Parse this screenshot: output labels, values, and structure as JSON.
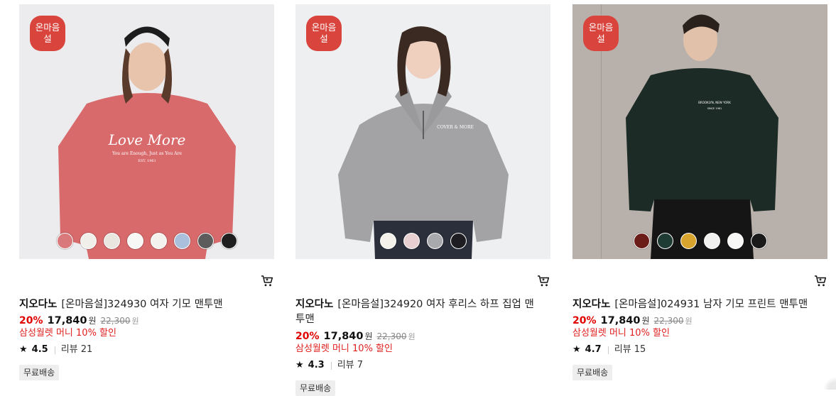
{
  "products": [
    {
      "badge": [
        "온마음",
        "설"
      ],
      "brand": "지오다노",
      "name": "[온마음설]324930 여자 기모 맨투맨",
      "discount": "20%",
      "price": "17,840",
      "currency": "원",
      "original_price": "22,300",
      "promo": "삼성월렛 머니 10% 할인",
      "rating": "4.5",
      "review_label": "리뷰 21",
      "shipping": "무료배송",
      "photo_bg": "#ececee",
      "garment_color": "#d86a6c",
      "swatch_colors": [
        "#d9797b",
        "#f0efe9",
        "#e8e6df",
        "#f7f7f5",
        "#f3f2ee",
        "#a9bfdc",
        "#5c5c5c",
        "#1f1f1f"
      ]
    },
    {
      "badge": [
        "온마음",
        "설"
      ],
      "brand": "지오다노",
      "name": "[온마음설]324920 여자 후리스 하프 집업 맨투맨",
      "discount": "20%",
      "price": "17,840",
      "currency": "원",
      "original_price": "22,300",
      "promo": "삼성월렛 머니 10% 할인",
      "rating": "4.3",
      "review_label": "리뷰 7",
      "shipping": "무료배송",
      "photo_bg": "#eeeff1",
      "garment_color": "#a3a3a5",
      "swatch_colors": [
        "#f3f1ea",
        "#e8cfd2",
        "#a7a9ad",
        "#1e1e22"
      ]
    },
    {
      "badge": [
        "온마음",
        "설"
      ],
      "brand": "지오다노",
      "name": "[온마음설]024931 남자 기모 프린트 맨투맨",
      "discount": "20%",
      "price": "17,840",
      "currency": "원",
      "original_price": "22,300",
      "promo": "삼성월렛 머니 10% 할인",
      "rating": "4.7",
      "review_label": "리뷰 15",
      "shipping": "무료배송",
      "photo_bg": "#b8b0aa",
      "garment_color": "#1c2b26",
      "swatch_colors": [
        "#6b1d1a",
        "#1e3c34",
        "#d9a42e",
        "#f1f1ef",
        "#f8f8f6",
        "#1a1a1a"
      ]
    }
  ],
  "icons": {
    "cart": "shopping-cart-icon",
    "star": "star-icon"
  },
  "colors": {
    "accent_red": "#e00000",
    "badge_red": "#d9443d"
  }
}
